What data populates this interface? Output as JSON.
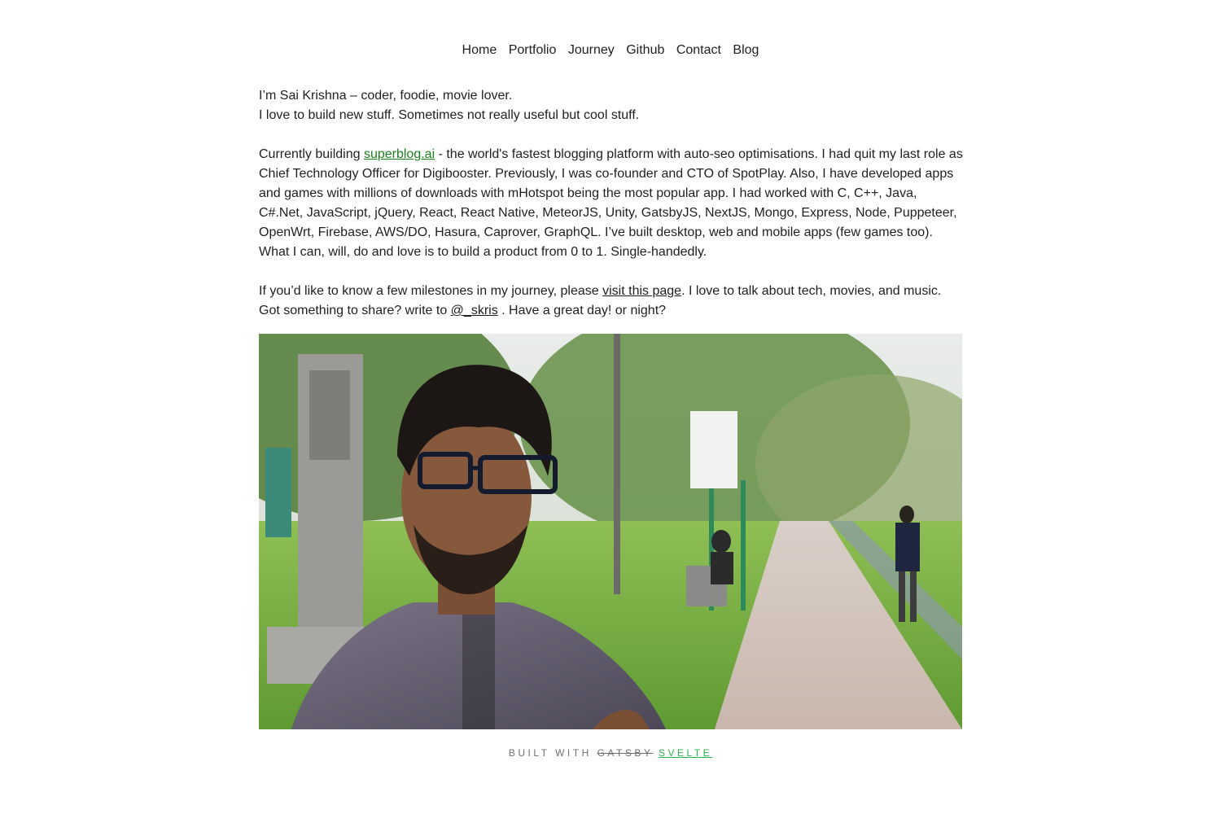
{
  "nav": {
    "items": [
      "Home",
      "Portfolio",
      "Journey",
      "Github",
      "Contact",
      "Blog"
    ]
  },
  "intro": {
    "line1": "I’m Sai Krishna – coder, foodie, movie lover.",
    "line2": "I love to build new stuff. Sometimes not really useful but cool stuff."
  },
  "current": {
    "prefix": "Currently building ",
    "link": "superblog.ai",
    "rest": " - the world's fastest blogging platform with auto-seo optimisations. I had quit my last role as Chief Technology Officer for Digibooster. Previously, I was co-founder and CTO of SpotPlay. Also, I have developed apps and games with millions of downloads with mHotspot being the most popular app. I had worked with C, C++, Java, C#.Net, JavaScript, jQuery, React, React Native, MeteorJS, Unity, GatsbyJS, NextJS, Mongo, Express, Node, Puppeteer, OpenWrt, Firebase, AWS/DO, Hasura, Caprover, GraphQL. I’ve built desktop, web and mobile apps (few games too). What I can, will, do and love is to build a product from 0 to 1. Single-handedly."
  },
  "journey": {
    "prefix": "If you’d like to know a few milestones in my journey, please ",
    "link": "visit this page",
    "middle": ". I love to talk about tech, movies, and music. Got something to share? write to ",
    "handle": "@_skris",
    "suffix": " . Have a great day! or night?"
  },
  "footer": {
    "prefix": "BUILT WITH",
    "old": "GATSBY",
    "new": "SVELTE"
  },
  "colors": {
    "link_green": "#1a7f1a",
    "svelte_green": "#2db04b"
  }
}
